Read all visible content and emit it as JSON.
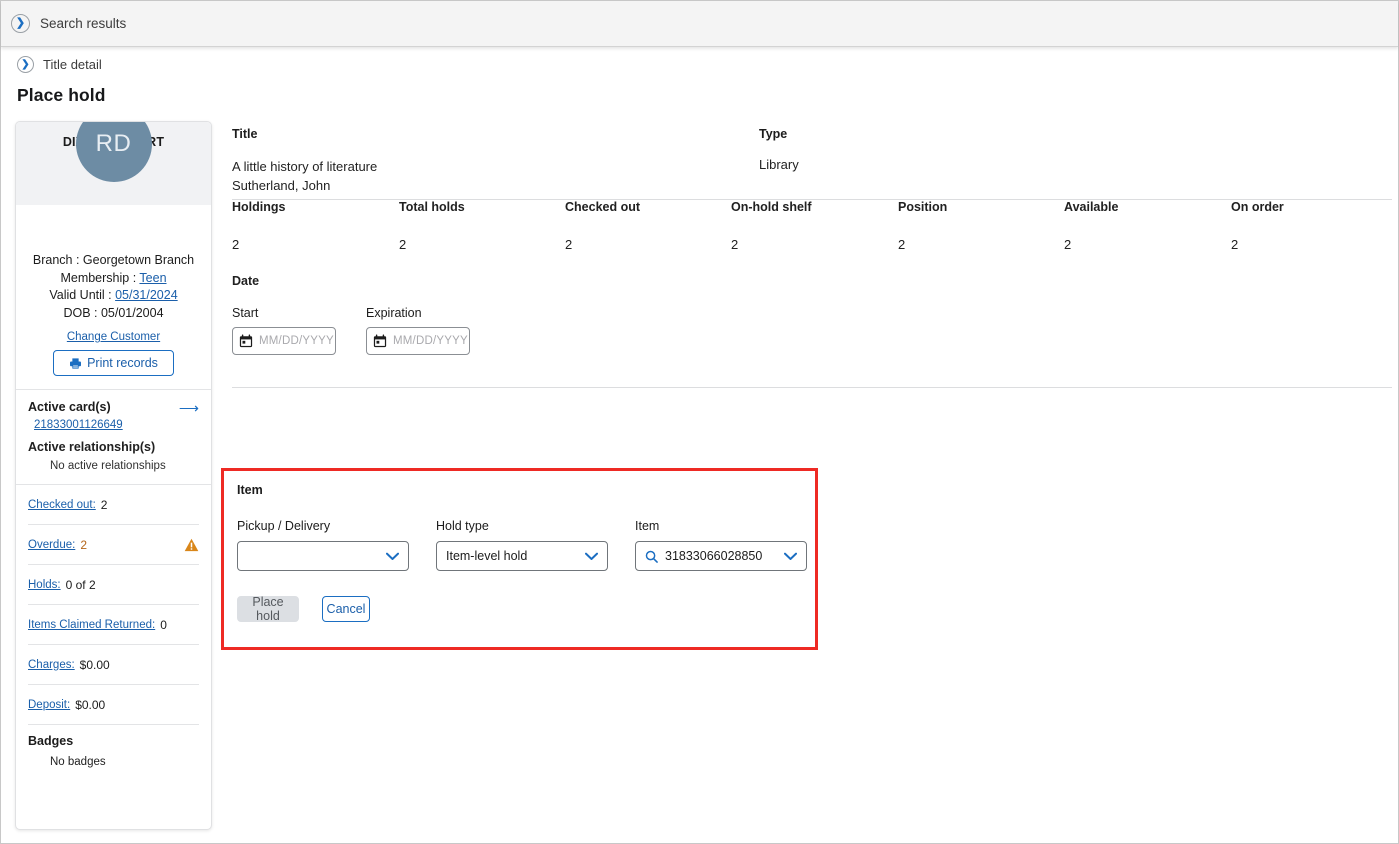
{
  "breadcrumbs": {
    "top": {
      "label": "Search results",
      "icon": "chevron-right-circle-icon"
    },
    "second": {
      "label": "Title detail",
      "icon": "chevron-right-circle-icon"
    }
  },
  "page_title": "Place hold",
  "patron": {
    "name": "DIXON, ROBERT",
    "initials": "RD",
    "branch_label": "Branch : ",
    "branch_value": "Georgetown Branch",
    "membership_label": "Membership : ",
    "membership_value": "Teen",
    "valid_until_label": "Valid Until : ",
    "valid_until_value": "05/31/2024",
    "dob_label": "DOB : ",
    "dob_value": "05/01/2004",
    "change_customer": "Change Customer",
    "print_records": "Print records",
    "active_cards_title": "Active card(s)",
    "card_number": "21833001126649",
    "active_relationships_title": "Active relationship(s)",
    "no_relationships": "No active relationships",
    "stats": [
      {
        "label": "Checked out:",
        "value": "2",
        "warning": false
      },
      {
        "label": "Overdue:",
        "value": "2",
        "warning": true
      },
      {
        "label": "Holds:",
        "value": "0 of 2",
        "warning": false
      },
      {
        "label": "Items Claimed Returned:",
        "value": "0",
        "warning": false
      },
      {
        "label": "Charges:",
        "value": "$0.00",
        "warning": false
      },
      {
        "label": "Deposit:",
        "value": "$0.00",
        "warning": false
      }
    ],
    "badges_title": "Badges",
    "badges_none": "No badges"
  },
  "title_section": {
    "title_label": "Title",
    "title_value": "A little history of literature",
    "author_value": "Sutherland, John",
    "type_label": "Type",
    "type_value": "Library"
  },
  "stats_columns": [
    {
      "header": "Holdings",
      "value": "2"
    },
    {
      "header": "Total holds",
      "value": "2"
    },
    {
      "header": "Checked out",
      "value": "2"
    },
    {
      "header": "On-hold shelf",
      "value": "2"
    },
    {
      "header": "Position",
      "value": "2"
    },
    {
      "header": "Available",
      "value": "2"
    },
    {
      "header": "On order",
      "value": "2"
    }
  ],
  "date_section": {
    "header": "Date",
    "start_label": "Start",
    "start_value": "",
    "start_placeholder": "MM/DD/YYYY",
    "expiration_label": "Expiration",
    "expiration_value": "",
    "expiration_placeholder": "MM/DD/YYYY"
  },
  "item_section": {
    "header": "Item",
    "pickup_label": "Pickup / Delivery",
    "pickup_value": "",
    "hold_type_label": "Hold type",
    "hold_type_value": "Item-level hold",
    "item_label": "Item",
    "item_value": "31833066028850",
    "place_hold_button": "Place hold",
    "cancel_button": "Cancel",
    "highlight_color": "#ee2a24"
  },
  "colors": {
    "accent_blue": "#1b6ec2",
    "link_blue": "#1b5faa",
    "avatar_bg": "#6d8ca4",
    "warning_orange": "#d9861a",
    "header_bg": "#f4f4f4",
    "card_head_bg": "#f1f2f4"
  }
}
